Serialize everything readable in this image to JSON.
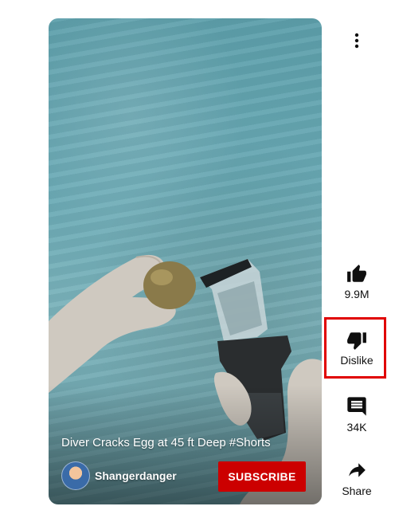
{
  "video": {
    "title": "Diver Cracks Egg at 45 ft Deep #Shorts",
    "channel_name": "Shangerdanger",
    "subscribe_label": "SUBSCRIBE"
  },
  "actions": {
    "like_count": "9.9M",
    "dislike_label": "Dislike",
    "comment_count": "34K",
    "share_label": "Share"
  },
  "icons": {
    "more": "more-vert-icon",
    "like": "thumb-up-icon",
    "dislike": "thumb-down-icon",
    "comments": "comment-icon",
    "share": "share-icon"
  },
  "colors": {
    "subscribe_bg": "#cc0000",
    "highlight_border": "#e00000",
    "icon": "#0f0f0f"
  }
}
